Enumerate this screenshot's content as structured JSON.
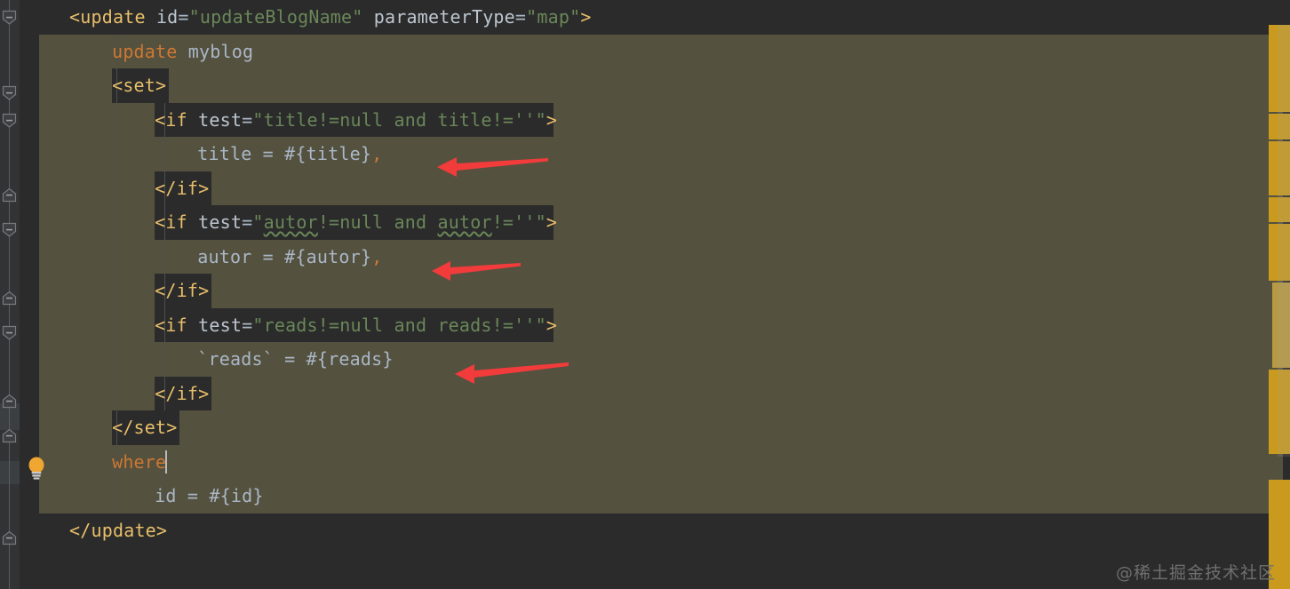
{
  "editor": {
    "language": "XML",
    "theme": "Darcula",
    "colors": {
      "background": "#2b2b2b",
      "gutter": "#313335",
      "selection": "#55513f",
      "tag": "#e8bf6a",
      "attribute_name": "#bcc6d0",
      "attribute_value": "#6a8759",
      "sql_keyword": "#cc7832",
      "plain_text": "#a9b7c6",
      "arrow": "#f23b3b",
      "error_stripe": "#c99a1e",
      "caret": "#bbbbbb",
      "indent_guide": "#4e4e4e"
    }
  },
  "code": {
    "lines": [
      {
        "indent": 0,
        "highlight": "tag",
        "tokens": [
          {
            "t": "<update ",
            "c": "tag"
          },
          {
            "t": "id",
            "c": "attr"
          },
          {
            "t": "=",
            "c": "punc"
          },
          {
            "t": "\"updateBlogName\"",
            "c": "str"
          },
          {
            "t": " ",
            "c": "punc"
          },
          {
            "t": "parameterType",
            "c": "attr"
          },
          {
            "t": "=",
            "c": "punc"
          },
          {
            "t": "\"map\"",
            "c": "str"
          },
          {
            "t": ">",
            "c": "tag"
          }
        ]
      },
      {
        "indent": 1,
        "highlight": "none",
        "tokens": [
          {
            "t": "update",
            "c": "kw"
          },
          {
            "t": " myblog",
            "c": "txt"
          }
        ]
      },
      {
        "indent": 1,
        "highlight": "tag",
        "tokens": [
          {
            "t": "<set>",
            "c": "tag"
          }
        ]
      },
      {
        "indent": 2,
        "highlight": "tag",
        "tokens": [
          {
            "t": "<if ",
            "c": "tag"
          },
          {
            "t": "test",
            "c": "attr"
          },
          {
            "t": "=",
            "c": "punc"
          },
          {
            "t": "\"title!=null and title!=''\"",
            "c": "str"
          },
          {
            "t": ">",
            "c": "tag"
          }
        ]
      },
      {
        "indent": 3,
        "highlight": "none",
        "tokens": [
          {
            "t": "title = #{title}",
            "c": "txt"
          },
          {
            "t": ",",
            "c": "comma"
          }
        ]
      },
      {
        "indent": 2,
        "highlight": "tag",
        "tokens": [
          {
            "t": "</if>",
            "c": "tag"
          }
        ]
      },
      {
        "indent": 2,
        "highlight": "tag",
        "tokens": [
          {
            "t": "<if ",
            "c": "tag"
          },
          {
            "t": "test",
            "c": "attr"
          },
          {
            "t": "=",
            "c": "punc"
          },
          {
            "t": "\"",
            "c": "str"
          },
          {
            "t": "autor",
            "c": "str wavy"
          },
          {
            "t": "!=null and ",
            "c": "str"
          },
          {
            "t": "autor",
            "c": "str wavy"
          },
          {
            "t": "!=''\"",
            "c": "str"
          },
          {
            "t": ">",
            "c": "tag"
          }
        ]
      },
      {
        "indent": 3,
        "highlight": "none",
        "tokens": [
          {
            "t": "autor = #{autor}",
            "c": "txt"
          },
          {
            "t": ",",
            "c": "comma"
          }
        ]
      },
      {
        "indent": 2,
        "highlight": "tag",
        "tokens": [
          {
            "t": "</if>",
            "c": "tag"
          }
        ]
      },
      {
        "indent": 2,
        "highlight": "tag",
        "tokens": [
          {
            "t": "<if ",
            "c": "tag"
          },
          {
            "t": "test",
            "c": "attr"
          },
          {
            "t": "=",
            "c": "punc"
          },
          {
            "t": "\"reads!=null and reads!=''\"",
            "c": "str"
          },
          {
            "t": ">",
            "c": "tag"
          }
        ]
      },
      {
        "indent": 3,
        "highlight": "none",
        "tokens": [
          {
            "t": "`reads` = #{reads}",
            "c": "txt"
          }
        ]
      },
      {
        "indent": 2,
        "highlight": "tag",
        "tokens": [
          {
            "t": "</if>",
            "c": "tag"
          }
        ]
      },
      {
        "indent": 1,
        "highlight": "tag",
        "tokens": [
          {
            "t": "</set>",
            "c": "tag"
          }
        ]
      },
      {
        "indent": 1,
        "highlight": "none",
        "tokens": [
          {
            "t": "where",
            "c": "kw"
          }
        ]
      },
      {
        "indent": 2,
        "highlight": "none",
        "tokens": [
          {
            "t": "id = #{id}",
            "c": "txt"
          }
        ]
      },
      {
        "indent": 0,
        "highlight": "tag",
        "tokens": [
          {
            "t": "</update>",
            "c": "tag"
          }
        ]
      }
    ]
  },
  "annotations": {
    "arrows": [
      {
        "label": "arrow-pointing-to-title-assignment",
        "target": "title = #{title},"
      },
      {
        "label": "arrow-pointing-to-autor-assignment",
        "target": "autor = #{autor},"
      },
      {
        "label": "arrow-pointing-to-reads-assignment",
        "target": "`reads` = #{reads}"
      }
    ],
    "intention_bulb": "show-intention-actions",
    "caret_after": "where"
  },
  "watermark": {
    "text": "@稀土掘金技术社区"
  }
}
